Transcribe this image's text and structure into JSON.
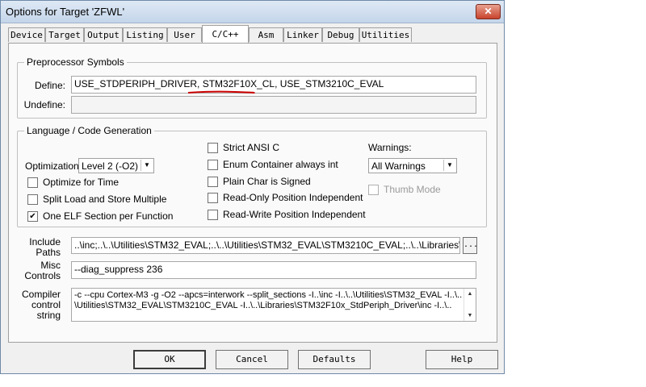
{
  "window": {
    "title": "Options for Target 'ZFWL'"
  },
  "tabs": [
    {
      "label": "Device"
    },
    {
      "label": "Target"
    },
    {
      "label": "Output"
    },
    {
      "label": "Listing"
    },
    {
      "label": "User"
    },
    {
      "label": "C/C++"
    },
    {
      "label": "Asm"
    },
    {
      "label": "Linker"
    },
    {
      "label": "Debug"
    },
    {
      "label": "Utilities"
    }
  ],
  "active_tab": "C/C++",
  "preprocessor": {
    "group_label": "Preprocessor Symbols",
    "define_label": "Define:",
    "define_value": "USE_STDPERIPH_DRIVER, STM32F10X_CL, USE_STM3210C_EVAL",
    "undefine_label": "Undefine:",
    "undefine_value": ""
  },
  "language": {
    "group_label": "Language / Code Generation",
    "optimization_label": "Optimization:",
    "optimization_value": "Level 2 (-O2)",
    "optimize_for_time": {
      "label": "Optimize for Time",
      "checked": false
    },
    "split_load_store": {
      "label": "Split Load and Store Multiple",
      "checked": false
    },
    "one_elf_section": {
      "label": "One ELF Section per Function",
      "checked": true
    },
    "strict_ansi": {
      "label": "Strict ANSI C",
      "checked": false
    },
    "enum_container": {
      "label": "Enum Container always int",
      "checked": false
    },
    "plain_char_signed": {
      "label": "Plain Char is Signed",
      "checked": false
    },
    "ro_pos_indep": {
      "label": "Read-Only Position Independent",
      "checked": false
    },
    "rw_pos_indep": {
      "label": "Read-Write Position Independent",
      "checked": false
    },
    "warnings_label": "Warnings:",
    "warnings_value": "All Warnings",
    "thumb_mode": {
      "label": "Thumb Mode",
      "checked": false,
      "enabled": false
    }
  },
  "include_paths": {
    "label_line1": "Include",
    "label_line2": "Paths",
    "value": "..\\inc;..\\..\\Utilities\\STM32_EVAL;..\\..\\Utilities\\STM32_EVAL\\STM3210C_EVAL;..\\..\\Libraries\\STM3",
    "browse_label": "..."
  },
  "misc_controls": {
    "label_line1": "Misc",
    "label_line2": "Controls",
    "value": "--diag_suppress 236"
  },
  "compiler_control": {
    "label_line1": "Compiler",
    "label_line2": "control",
    "label_line3": "string",
    "line1": "-c --cpu Cortex-M3 -g -O2 --apcs=interwork --split_sections -I..\\inc -I..\\..\\Utilities\\STM32_EVAL -I..\\..",
    "line2": "\\Utilities\\STM32_EVAL\\STM3210C_EVAL -I..\\..\\Libraries\\STM32F10x_StdPeriph_Driver\\inc -I..\\.."
  },
  "buttons": {
    "ok": "OK",
    "cancel": "Cancel",
    "defaults": "Defaults",
    "help": "Help"
  },
  "colors": {
    "annotation_underline": "#cc0000",
    "title_gradient": "#c4d5ea",
    "close_button": "#c8432c"
  }
}
